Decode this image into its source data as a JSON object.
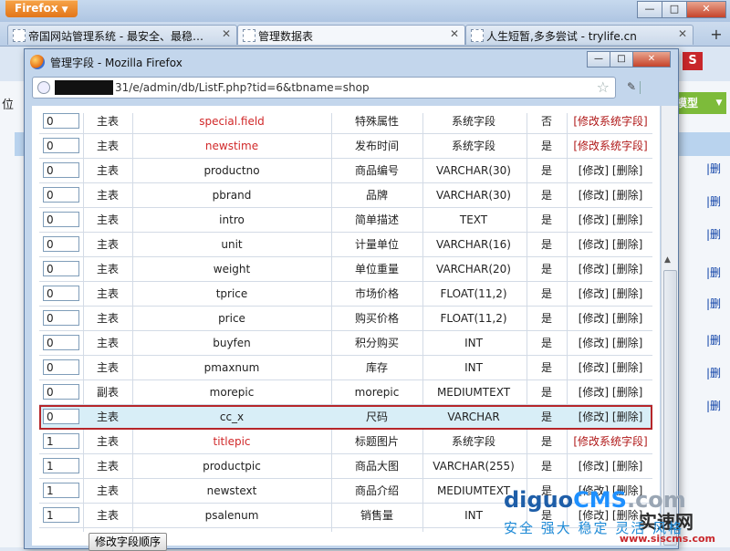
{
  "browser": {
    "menu_button": "Firefox",
    "tabs": [
      {
        "label": "帝国网站管理系统 - 最安全、最稳…",
        "active": false
      },
      {
        "label": "管理数据表",
        "active": true
      },
      {
        "label": "人生短暂,多多尝试 - trylife.cn",
        "active": false
      }
    ],
    "new_tab": "+"
  },
  "background": {
    "left_char": "位",
    "green_button": "模型",
    "row_ops": [
      "|删",
      "|删",
      "|删",
      "|删",
      "|删",
      "|删",
      "|删",
      "|删",
      "|删",
      "|删",
      "|删",
      "|删"
    ]
  },
  "popup": {
    "title": "管理字段 - Mozilla Firefox",
    "url": "31/e/admin/db/ListF.php?tid=6&tbname=shop"
  },
  "fields": [
    {
      "order": "0",
      "table": "主表",
      "field": "special.field",
      "label": "特殊属性",
      "type": "系统字段",
      "null": "否",
      "ops": "[修改系统字段]",
      "system": true
    },
    {
      "order": "0",
      "table": "主表",
      "field": "newstime",
      "label": "发布时间",
      "type": "系统字段",
      "null": "是",
      "ops": "[修改系统字段]",
      "system": true
    },
    {
      "order": "0",
      "table": "主表",
      "field": "productno",
      "label": "商品编号",
      "type": "VARCHAR(30)",
      "null": "是",
      "ops": "[修改] [删除]",
      "system": false
    },
    {
      "order": "0",
      "table": "主表",
      "field": "pbrand",
      "label": "品牌",
      "type": "VARCHAR(30)",
      "null": "是",
      "ops": "[修改] [删除]",
      "system": false
    },
    {
      "order": "0",
      "table": "主表",
      "field": "intro",
      "label": "简单描述",
      "type": "TEXT",
      "null": "是",
      "ops": "[修改] [删除]",
      "system": false
    },
    {
      "order": "0",
      "table": "主表",
      "field": "unit",
      "label": "计量单位",
      "type": "VARCHAR(16)",
      "null": "是",
      "ops": "[修改] [删除]",
      "system": false
    },
    {
      "order": "0",
      "table": "主表",
      "field": "weight",
      "label": "单位重量",
      "type": "VARCHAR(20)",
      "null": "是",
      "ops": "[修改] [删除]",
      "system": false
    },
    {
      "order": "0",
      "table": "主表",
      "field": "tprice",
      "label": "市场价格",
      "type": "FLOAT(11,2)",
      "null": "是",
      "ops": "[修改] [删除]",
      "system": false
    },
    {
      "order": "0",
      "table": "主表",
      "field": "price",
      "label": "购买价格",
      "type": "FLOAT(11,2)",
      "null": "是",
      "ops": "[修改] [删除]",
      "system": false
    },
    {
      "order": "0",
      "table": "主表",
      "field": "buyfen",
      "label": "积分购买",
      "type": "INT",
      "null": "是",
      "ops": "[修改] [删除]",
      "system": false
    },
    {
      "order": "0",
      "table": "主表",
      "field": "pmaxnum",
      "label": "库存",
      "type": "INT",
      "null": "是",
      "ops": "[修改] [删除]",
      "system": false
    },
    {
      "order": "0",
      "table": "副表",
      "field": "morepic",
      "label": "morepic",
      "type": "MEDIUMTEXT",
      "null": "是",
      "ops": "[修改] [删除]",
      "system": false
    },
    {
      "order": "0",
      "table": "主表",
      "field": "cc_x",
      "label": "尺码",
      "type": "VARCHAR",
      "null": "是",
      "ops": "[修改] [删除]",
      "system": false,
      "highlight": true
    },
    {
      "order": "1",
      "table": "主表",
      "field": "titlepic",
      "label": "标题图片",
      "type": "系统字段",
      "null": "是",
      "ops": "[修改系统字段]",
      "system": true
    },
    {
      "order": "1",
      "table": "主表",
      "field": "productpic",
      "label": "商品大图",
      "type": "VARCHAR(255)",
      "null": "是",
      "ops": "[修改] [删除]",
      "system": false
    },
    {
      "order": "1",
      "table": "主表",
      "field": "newstext",
      "label": "商品介绍",
      "type": "MEDIUMTEXT",
      "null": "是",
      "ops": "[修改] [删除]",
      "system": false
    },
    {
      "order": "1",
      "table": "主表",
      "field": "psalenum",
      "label": "销售量",
      "type": "INT",
      "null": "是",
      "ops": "[修改] [删除]",
      "system": false
    }
  ],
  "modify_order_button": "修改字段顺序",
  "watermark": {
    "brand_a": "diguo",
    "brand_b": "CMS",
    "brand_c": ".com",
    "fast": "实速网",
    "slogan": "安全 强大 稳定 灵活 风格",
    "url": "www.siscms.com"
  },
  "colors": {
    "system_field_red": "#d1292a",
    "highlight_border": "#b6262a",
    "highlight_bg": "#d8eef7"
  }
}
